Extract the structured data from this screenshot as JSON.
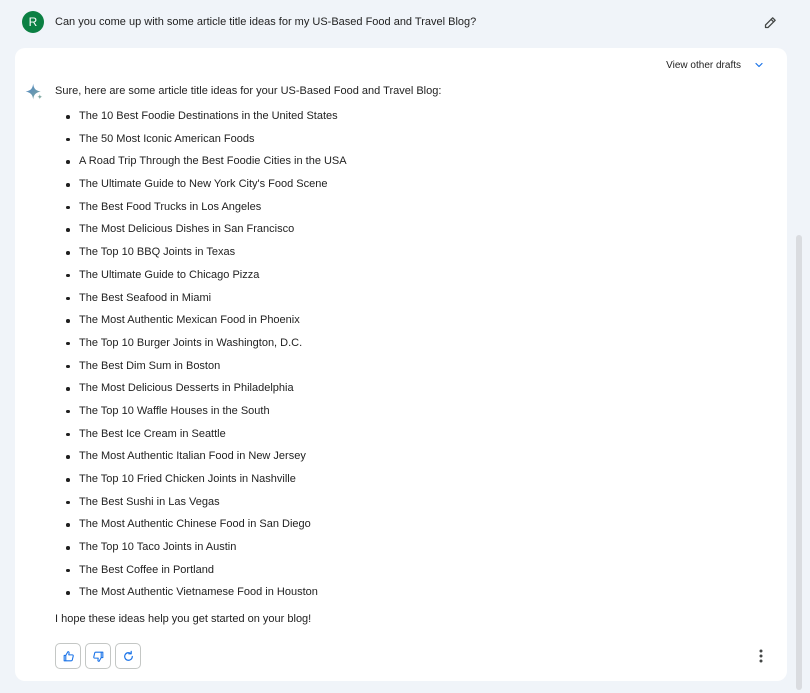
{
  "prompt": {
    "avatar_initial": "R",
    "text": "Can you come up with some article title ideas for my US-Based Food and Travel Blog?",
    "edit_icon": "pencil-icon"
  },
  "response": {
    "drafts_label": "View other drafts",
    "drafts_icon": "chevron-down-icon",
    "assistant_icon": "sparkle-icon",
    "intro": "Sure, here are some article title ideas for your US-Based Food and Travel Blog:",
    "ideas": [
      "The 10 Best Foodie Destinations in the United States",
      "The 50 Most Iconic American Foods",
      "A Road Trip Through the Best Foodie Cities in the USA",
      "The Ultimate Guide to New York City's Food Scene",
      "The Best Food Trucks in Los Angeles",
      "The Most Delicious Dishes in San Francisco",
      "The Top 10 BBQ Joints in Texas",
      "The Ultimate Guide to Chicago Pizza",
      "The Best Seafood in Miami",
      "The Most Authentic Mexican Food in Phoenix",
      "The Top 10 Burger Joints in Washington, D.C.",
      "The Best Dim Sum in Boston",
      "The Most Delicious Desserts in Philadelphia",
      "The Top 10 Waffle Houses in the South",
      "The Best Ice Cream in Seattle",
      "The Most Authentic Italian Food in New Jersey",
      "The Top 10 Fried Chicken Joints in Nashville",
      "The Best Sushi in Las Vegas",
      "The Most Authentic Chinese Food in San Diego",
      "The Top 10 Taco Joints in Austin",
      "The Best Coffee in Portland",
      "The Most Authentic Vietnamese Food in Houston"
    ],
    "outro": "I hope these ideas help you get started on your blog!",
    "action_icons": [
      "thumbs-up-icon",
      "thumbs-down-icon",
      "regenerate-icon"
    ],
    "more_icon": "more-vert-icon"
  },
  "colors": {
    "page_background": "#f0f4f9",
    "card_background": "#ffffff",
    "avatar": "#0b8043",
    "accent": "#1a73e8",
    "icon": "#444746"
  }
}
